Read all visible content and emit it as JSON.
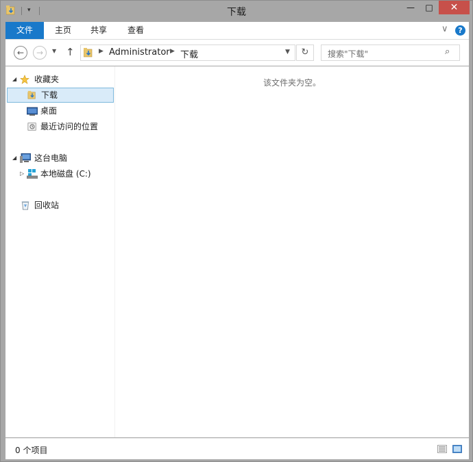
{
  "window": {
    "title": "下载",
    "minimize_glyph": "—",
    "maximize_glyph": "□",
    "close_glyph": "✕"
  },
  "ribbon": {
    "tabs": [
      "文件",
      "主页",
      "共享",
      "查看"
    ],
    "collapse_glyph": "∨",
    "help_glyph": "?"
  },
  "navigation": {
    "back_glyph": "←",
    "forward_glyph": "→",
    "recent_glyph": "▼",
    "up_glyph": "↑",
    "breadcrumbs": [
      "Administrator",
      "下载"
    ],
    "refresh_glyph": "↻",
    "search_placeholder": "搜索\"下载\"",
    "search_glyph": "⌕"
  },
  "sidebar": {
    "favorites": {
      "label": "收藏夹",
      "expanded": true
    },
    "favorite_items": [
      {
        "label": "下载",
        "icon": "downloads-folder-icon",
        "selected": true
      },
      {
        "label": "桌面",
        "icon": "desktop-icon",
        "selected": false
      },
      {
        "label": "最近访问的位置",
        "icon": "recent-places-icon",
        "selected": false
      }
    ],
    "this_pc": {
      "label": "这台电脑",
      "expanded": true
    },
    "this_pc_items": [
      {
        "label": "本地磁盘 (C:)",
        "icon": "drive-icon",
        "selected": false
      }
    ],
    "recycle_bin": {
      "label": "回收站"
    }
  },
  "content": {
    "empty_message": "该文件夹为空。"
  },
  "status": {
    "item_count": "0 个项目"
  },
  "colors": {
    "accent": "#1979ca",
    "close_button": "#c7504a",
    "selection_fill": "#d9ebf9",
    "selection_border": "#7cb8dc"
  }
}
